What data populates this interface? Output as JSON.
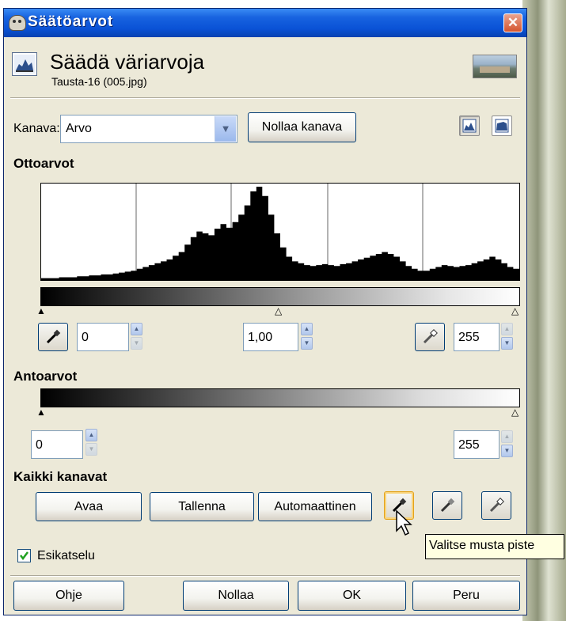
{
  "window": {
    "title": "Säätöarvot",
    "close_label": "✕"
  },
  "header": {
    "title": "Säädä väriarvoja",
    "subtitle": "Tausta-16 (005.jpg)"
  },
  "channel": {
    "label": "Kanava:",
    "value": "Arvo",
    "reset_button": "Nollaa kanava"
  },
  "input_levels": {
    "heading": "Ottoarvot",
    "low": "0",
    "gamma": "1,00",
    "high": "255"
  },
  "output_levels": {
    "heading": "Antoarvot",
    "low": "0",
    "high": "255"
  },
  "all_channels": {
    "heading": "Kaikki kanavat",
    "open_button": "Avaa",
    "save_button": "Tallenna",
    "auto_button": "Automaattinen"
  },
  "preview": {
    "label": "Esikatselu",
    "checked": true
  },
  "tooltip": {
    "text": "Valitse musta piste"
  },
  "footer": {
    "help_button": "Ohje",
    "reset_button": "Nollaa",
    "ok_button": "OK",
    "cancel_button": "Peru"
  },
  "colors": {
    "titlebar": "#0a52d6",
    "dialog_bg": "#ece9d8",
    "tooltip_bg": "#ffffe1",
    "button_border": "#003c74"
  },
  "histogram_data": {
    "scale": "linear",
    "bins": [
      0.02,
      0.02,
      0.02,
      0.03,
      0.03,
      0.03,
      0.04,
      0.04,
      0.05,
      0.05,
      0.06,
      0.06,
      0.07,
      0.08,
      0.09,
      0.1,
      0.12,
      0.14,
      0.16,
      0.18,
      0.2,
      0.22,
      0.26,
      0.3,
      0.38,
      0.46,
      0.52,
      0.5,
      0.48,
      0.55,
      0.6,
      0.56,
      0.62,
      0.7,
      0.8,
      0.95,
      1.0,
      0.9,
      0.7,
      0.5,
      0.35,
      0.25,
      0.2,
      0.18,
      0.16,
      0.15,
      0.16,
      0.17,
      0.16,
      0.15,
      0.17,
      0.18,
      0.2,
      0.22,
      0.24,
      0.26,
      0.28,
      0.3,
      0.28,
      0.25,
      0.2,
      0.15,
      0.12,
      0.1,
      0.1,
      0.12,
      0.14,
      0.16,
      0.15,
      0.14,
      0.15,
      0.16,
      0.18,
      0.2,
      0.22,
      0.25,
      0.22,
      0.18,
      0.14,
      0.12
    ]
  }
}
